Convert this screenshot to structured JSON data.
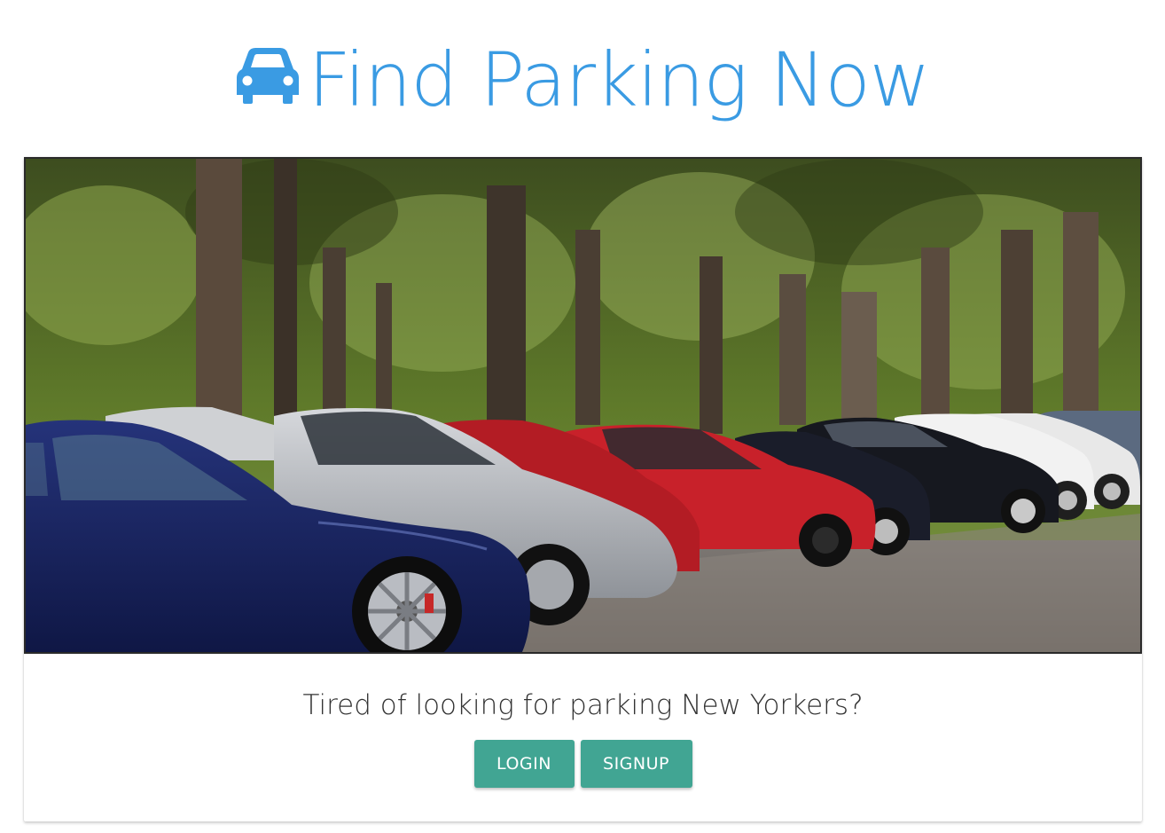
{
  "header": {
    "title": "Find Parking Now",
    "icon": "car-icon",
    "accent_color": "#3a9be3"
  },
  "hero": {
    "image": "parked-cars-photo"
  },
  "main": {
    "tagline": "Tired of looking for parking New Yorkers?",
    "login_label": "LOGIN",
    "signup_label": "SIGNUP",
    "button_color": "#41a593"
  }
}
